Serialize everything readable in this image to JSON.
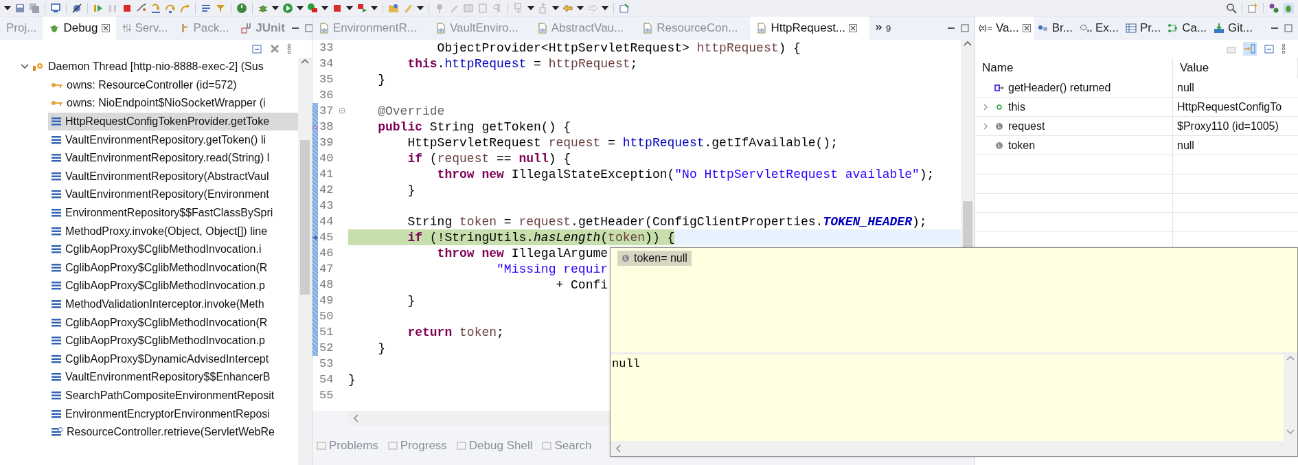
{
  "left_panel": {
    "tabs": [
      {
        "label": "Proj...",
        "selected": false
      },
      {
        "label": "Debug",
        "selected": true
      },
      {
        "label": "Serv...",
        "selected": false
      },
      {
        "label": "Pack...",
        "selected": false
      },
      {
        "label": "JUnit",
        "selected": false
      }
    ],
    "thread": {
      "label": "Daemon Thread [http-nio-8888-exec-2] (Sus",
      "expanded": true,
      "children": [
        {
          "kind": "monitor",
          "label": "owns: ResourceController  (id=572)",
          "selected": false
        },
        {
          "kind": "monitor",
          "label": "owns: NioEndpoint$NioSocketWrapper  (i",
          "selected": false
        },
        {
          "kind": "frame",
          "label": "HttpRequestConfigTokenProvider.getToke",
          "selected": true
        },
        {
          "kind": "frame",
          "label": "VaultEnvironmentRepository.getToken() li",
          "selected": false
        },
        {
          "kind": "frame",
          "label": "VaultEnvironmentRepository.read(String) l",
          "selected": false
        },
        {
          "kind": "frame",
          "label": "VaultEnvironmentRepository(AbstractVaul",
          "selected": false
        },
        {
          "kind": "frame",
          "label": "VaultEnvironmentRepository(Environment",
          "selected": false
        },
        {
          "kind": "frame",
          "label": "EnvironmentRepository$$FastClassBySpri",
          "selected": false
        },
        {
          "kind": "frame",
          "label": "MethodProxy.invoke(Object, Object[]) line",
          "selected": false
        },
        {
          "kind": "frame",
          "label": "CglibAopProxy$CglibMethodInvocation.i",
          "selected": false
        },
        {
          "kind": "frame",
          "label": "CglibAopProxy$CglibMethodInvocation(R",
          "selected": false
        },
        {
          "kind": "frame",
          "label": "CglibAopProxy$CglibMethodInvocation.p",
          "selected": false
        },
        {
          "kind": "frame",
          "label": "MethodValidationInterceptor.invoke(Meth",
          "selected": false
        },
        {
          "kind": "frame",
          "label": "CglibAopProxy$CglibMethodInvocation(R",
          "selected": false
        },
        {
          "kind": "frame",
          "label": "CglibAopProxy$CglibMethodInvocation.p",
          "selected": false
        },
        {
          "kind": "frame",
          "label": "CglibAopProxy$DynamicAdvisedIntercept",
          "selected": false
        },
        {
          "kind": "frame",
          "label": "VaultEnvironmentRepository$$EnhancerB",
          "selected": false
        },
        {
          "kind": "frame",
          "label": "SearchPathCompositeEnvironmentReposit",
          "selected": false
        },
        {
          "kind": "frame",
          "label": "EnvironmentEncryptorEnvironmentReposi",
          "selected": false
        },
        {
          "kind": "frame-stepping",
          "label": "ResourceController.retrieve(ServletWebRe",
          "selected": false
        }
      ]
    }
  },
  "editor": {
    "tabs": [
      {
        "label": "EnvironmentR...",
        "selected": false
      },
      {
        "label": "VaultEnviro...",
        "selected": false
      },
      {
        "label": "AbstractVau...",
        "selected": false
      },
      {
        "label": "ResourceCon...",
        "selected": false
      },
      {
        "label": "HttpRequest...",
        "selected": true
      }
    ],
    "more_tabs": "9",
    "lines": [
      {
        "number": "33",
        "changed": false,
        "current": false,
        "folding": false,
        "overrides": false,
        "segments": [
          {
            "kind": "plain",
            "t": "            ObjectProvider<HttpServletRequest> "
          },
          {
            "kind": "var",
            "t": "httpRequest"
          },
          {
            "kind": "plain",
            "t": ") {"
          }
        ]
      },
      {
        "number": "34",
        "changed": false,
        "current": false,
        "folding": false,
        "overrides": false,
        "segments": [
          {
            "kind": "kw",
            "t": "        this"
          },
          {
            "kind": "plain",
            "t": "."
          },
          {
            "kind": "field",
            "t": "httpRequest"
          },
          {
            "kind": "plain",
            "t": " = "
          },
          {
            "kind": "var",
            "t": "httpRequest"
          },
          {
            "kind": "plain",
            "t": ";"
          }
        ]
      },
      {
        "number": "35",
        "changed": false,
        "current": false,
        "folding": false,
        "overrides": false,
        "segments": [
          {
            "kind": "plain",
            "t": "    }"
          }
        ]
      },
      {
        "number": "36",
        "changed": false,
        "current": false,
        "folding": false,
        "overrides": false
      },
      {
        "number": "37",
        "changed": true,
        "current": false,
        "folding": true,
        "overrides": false,
        "segments": [
          {
            "kind": "annotation",
            "t": "    @Override"
          }
        ]
      },
      {
        "number": "38",
        "changed": true,
        "current": false,
        "folding": false,
        "overrides": true,
        "segments": [
          {
            "kind": "kw",
            "t": "    public"
          },
          {
            "kind": "plain",
            "t": " String getToken() {"
          }
        ]
      },
      {
        "number": "39",
        "changed": true,
        "current": false,
        "folding": false,
        "overrides": false,
        "segments": [
          {
            "kind": "plain",
            "t": "        HttpServletRequest "
          },
          {
            "kind": "var",
            "t": "request"
          },
          {
            "kind": "plain",
            "t": " = "
          },
          {
            "kind": "field",
            "t": "httpRequest"
          },
          {
            "kind": "plain",
            "t": ".getIfAvailable();"
          }
        ]
      },
      {
        "number": "40",
        "changed": true,
        "current": false,
        "folding": false,
        "overrides": false,
        "segments": [
          {
            "kind": "kw",
            "t": "        if"
          },
          {
            "kind": "plain",
            "t": " ("
          },
          {
            "kind": "var",
            "t": "request"
          },
          {
            "kind": "plain",
            "t": " == "
          },
          {
            "kind": "kw",
            "t": "null"
          },
          {
            "kind": "plain",
            "t": ") {"
          }
        ]
      },
      {
        "number": "41",
        "changed": true,
        "current": false,
        "folding": false,
        "overrides": false,
        "segments": [
          {
            "kind": "kw",
            "t": "            throw new"
          },
          {
            "kind": "plain",
            "t": " IllegalStateException("
          },
          {
            "kind": "str",
            "t": "\"No HttpServletRequest available\""
          },
          {
            "kind": "plain",
            "t": ");"
          }
        ]
      },
      {
        "number": "42",
        "changed": true,
        "current": false,
        "folding": false,
        "overrides": false,
        "segments": [
          {
            "kind": "plain",
            "t": "        }"
          }
        ]
      },
      {
        "number": "43",
        "changed": true,
        "current": false,
        "folding": false,
        "overrides": false
      },
      {
        "number": "44",
        "changed": true,
        "current": false,
        "folding": false,
        "overrides": false,
        "segments": [
          {
            "kind": "plain",
            "t": "        String "
          },
          {
            "kind": "var",
            "t": "token"
          },
          {
            "kind": "plain",
            "t": " = "
          },
          {
            "kind": "var",
            "t": "request"
          },
          {
            "kind": "plain",
            "t": ".getHeader(ConfigClientProperties."
          },
          {
            "kind": "const",
            "t": "TOKEN_HEADER"
          },
          {
            "kind": "plain",
            "t": ");"
          }
        ]
      },
      {
        "number": "45",
        "changed": true,
        "current": true,
        "folding": false,
        "overrides": false,
        "segments": [
          {
            "kind": "kw",
            "t": "        if"
          },
          {
            "kind": "plain",
            "t": " (!StringUtils."
          },
          {
            "kind": "italic",
            "t": "hasLength"
          },
          {
            "kind": "plain",
            "t": "("
          },
          {
            "kind": "var",
            "t": "token"
          },
          {
            "kind": "plain",
            "t": ")) {"
          }
        ]
      },
      {
        "number": "46",
        "changed": true,
        "current": false,
        "folding": false,
        "overrides": false,
        "segments": [
          {
            "kind": "kw",
            "t": "            throw new"
          },
          {
            "kind": "plain",
            "t": " IllegalArgume"
          }
        ]
      },
      {
        "number": "47",
        "changed": true,
        "current": false,
        "folding": false,
        "overrides": false,
        "segments": [
          {
            "kind": "str",
            "t": "                    \"Missing requir"
          }
        ]
      },
      {
        "number": "48",
        "changed": true,
        "current": false,
        "folding": false,
        "overrides": false,
        "segments": [
          {
            "kind": "plain",
            "t": "                            + Confi"
          }
        ]
      },
      {
        "number": "49",
        "changed": true,
        "current": false,
        "folding": false,
        "overrides": false,
        "segments": [
          {
            "kind": "plain",
            "t": "        }"
          }
        ]
      },
      {
        "number": "50",
        "changed": true,
        "current": false,
        "folding": false,
        "overrides": false
      },
      {
        "number": "51",
        "changed": true,
        "current": false,
        "folding": false,
        "overrides": false,
        "segments": [
          {
            "kind": "kw",
            "t": "        return"
          },
          {
            "kind": "var",
            "t": " token"
          },
          {
            "kind": "plain",
            "t": ";"
          }
        ]
      },
      {
        "number": "52",
        "changed": true,
        "current": false,
        "folding": false,
        "overrides": false,
        "segments": [
          {
            "kind": "plain",
            "t": "    }"
          }
        ]
      },
      {
        "number": "53",
        "changed": false,
        "current": false,
        "folding": false,
        "overrides": false
      },
      {
        "number": "54",
        "changed": false,
        "current": false,
        "folding": false,
        "overrides": false,
        "segments": [
          {
            "kind": "plain",
            "t": "}"
          }
        ]
      },
      {
        "number": "55",
        "changed": false,
        "current": false,
        "folding": false,
        "overrides": false
      }
    ]
  },
  "bottom_panel": {
    "tabs": [
      {
        "label": "Problems"
      },
      {
        "label": "Progress"
      },
      {
        "label": "Debug Shell"
      },
      {
        "label": "Search"
      }
    ]
  },
  "hover_popup": {
    "label": "token= null",
    "detail": "null"
  },
  "variables_panel": {
    "tabs": [
      {
        "label": "Va...",
        "selected": true
      },
      {
        "label": "Br...",
        "selected": false
      },
      {
        "label": "Ex...",
        "selected": false
      },
      {
        "label": "Pr...",
        "selected": false
      },
      {
        "label": "Ca...",
        "selected": false
      },
      {
        "label": "Git...",
        "selected": false
      }
    ],
    "columns": [
      "Name",
      "Value"
    ],
    "rows": [
      {
        "kind": "return",
        "name": "getHeader() returned",
        "value": "null",
        "has_children": false
      },
      {
        "kind": "field",
        "name": "this",
        "value": "HttpRequestConfigTo",
        "has_children": true
      },
      {
        "kind": "local",
        "name": "request",
        "value": "$Proxy110  (id=1005)",
        "has_children": true
      },
      {
        "kind": "local",
        "name": "token",
        "value": "null",
        "has_children": false
      }
    ]
  }
}
